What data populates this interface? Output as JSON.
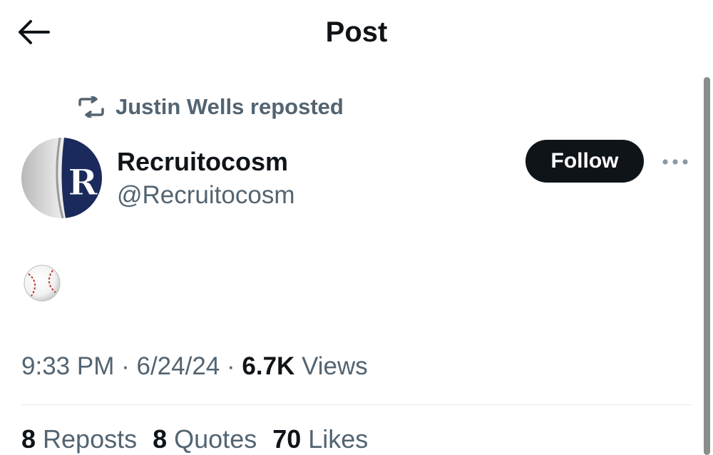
{
  "header": {
    "title": "Post",
    "back_icon": "arrow-left-icon"
  },
  "repost": {
    "text": "Justin Wells reposted",
    "icon": "repost-icon"
  },
  "author": {
    "name": "Recruitocosm",
    "handle": "@Recruitocosm",
    "avatar_letter": "R"
  },
  "follow_label": "Follow",
  "more_icon": "more-horizontal-icon",
  "content": {
    "emoji": "baseball"
  },
  "meta": {
    "time": "9:33 PM",
    "date": "6/24/24",
    "sep": "·",
    "views_count": "6.7K",
    "views_label": "Views"
  },
  "stats": {
    "reposts": {
      "count": "8",
      "label": "Reposts"
    },
    "quotes": {
      "count": "8",
      "label": "Quotes"
    },
    "likes": {
      "count": "70",
      "label": "Likes"
    }
  },
  "colors": {
    "text": "#0f1419",
    "secondary": "#536471",
    "follow_bg": "#0f1419",
    "avatar_navy": "#1a2a5c"
  }
}
